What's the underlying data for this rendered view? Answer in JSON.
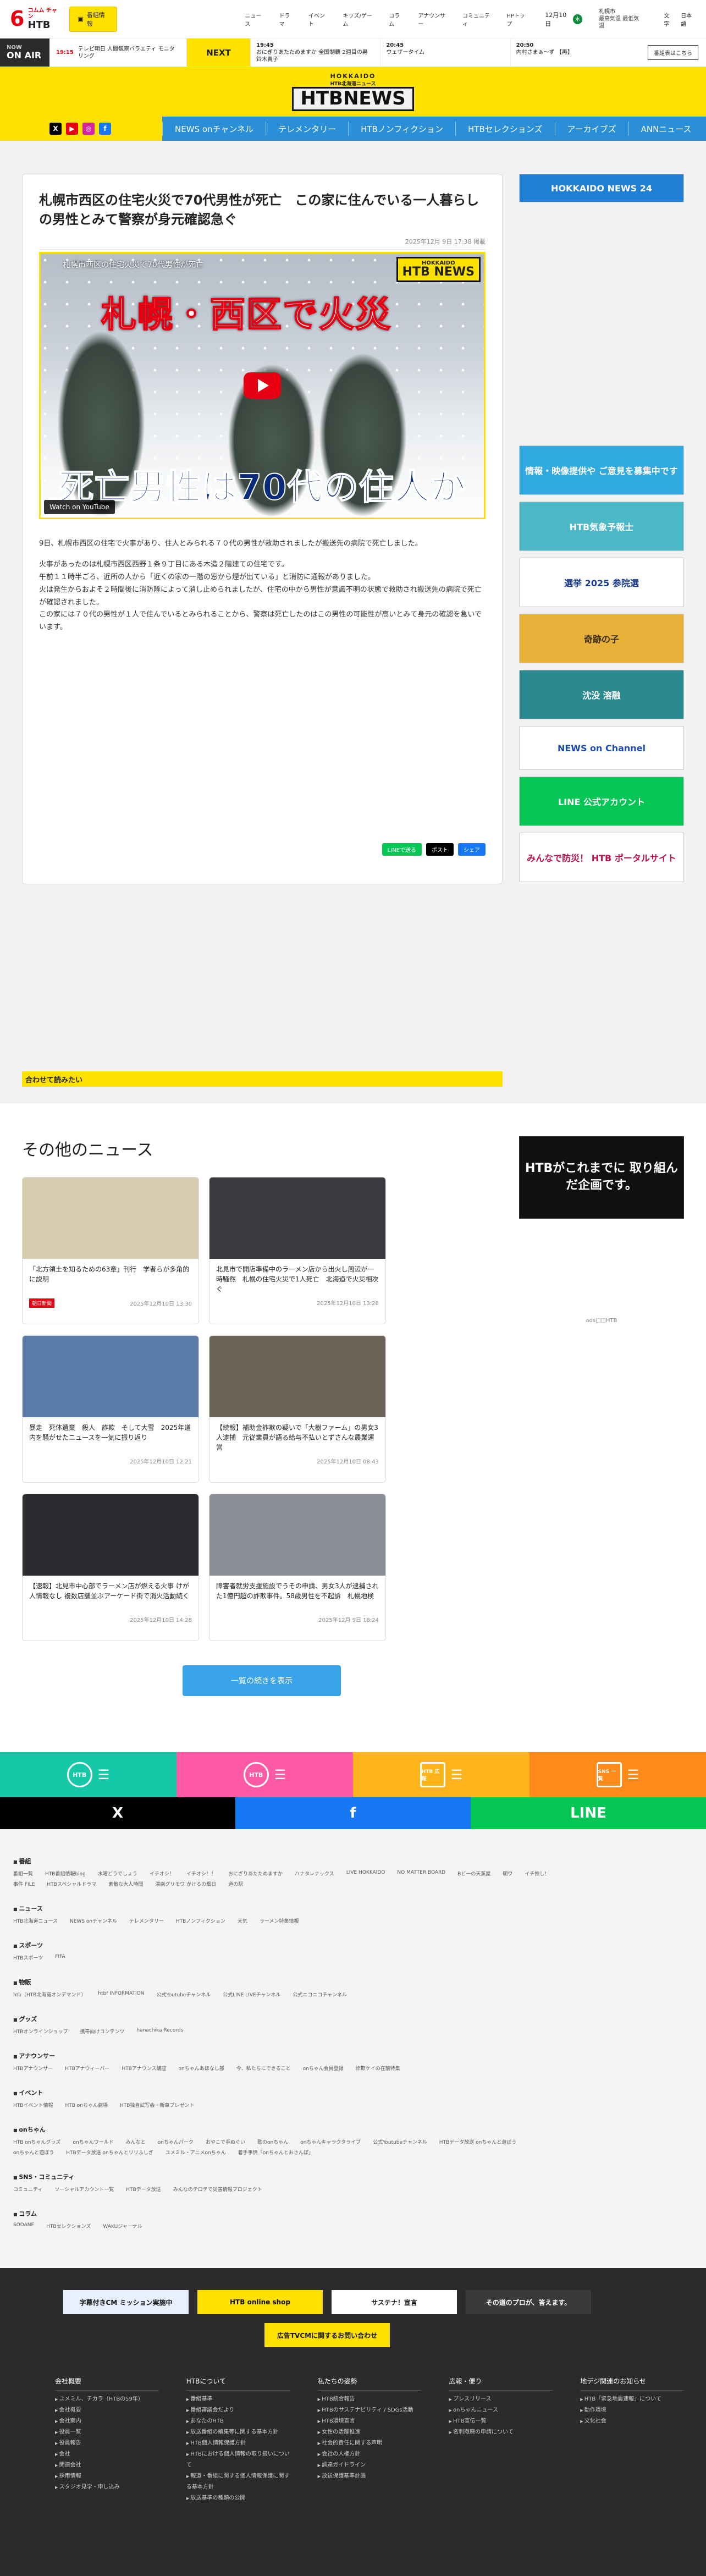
{
  "header": {
    "logo_six": "6",
    "logo_top": "コムム チャン",
    "logo_main": "HTB",
    "tv_button": "番組情報",
    "nav": [
      "ニュース",
      "ドラマ",
      "イベント",
      "キッズ/ゲーム",
      "コラム",
      "アナウンサー",
      "コミュニティ",
      "HPトップ"
    ],
    "date": "12月10日",
    "date_day": "水",
    "weather_top": "札幌市",
    "weather_sub": "最高気温 最低気温",
    "kanji": [
      "文字",
      "日本語"
    ]
  },
  "onair": {
    "label": "ON AIR",
    "now": "NOW",
    "now_time": "19:15",
    "now_title": "テレビ朝日 人間観察バラエティ モニタリング",
    "next_tag": "NEXT",
    "items": [
      {
        "time": "19:45",
        "title": "おにぎりあたためますか 全国制覇 2週目の男 鈴木貴子"
      },
      {
        "time": "20:45",
        "title": "ウェザータイム"
      },
      {
        "time": "20:50",
        "title": "内村さまぁ～ず 【再】"
      }
    ],
    "program_button": "番組表はこちら"
  },
  "brand": {
    "hokkaido": "HOKKAIDO",
    "sub": "HTB北海道ニュース",
    "logo": "HTBNEWS"
  },
  "subnav": [
    "NEWS onチャンネル",
    "テレメンタリー",
    "HTBノンフィクション",
    "HTBセレクションズ",
    "アーカイブズ",
    "ANNニュース"
  ],
  "article": {
    "title": "札幌市西区の住宅火災で70代男性が死亡　この家に住んでいる一人暮らしの男性とみて警察が身元確認急ぐ",
    "date": "2025年12月 9日 17:38 掲載",
    "video": {
      "caption": "札幌市西区の住宅火災で70代男性が死亡",
      "headline_top": "札幌・西区で火災",
      "headline_bottom": "死亡男性は70代の住人か",
      "badge_top": "HOKKAIDO",
      "badge_main": "HTB NEWS",
      "watch_on": "Watch on YouTube"
    },
    "paragraphs": [
      "9日、札幌市西区の住宅で火事があり、住人とみられる７０代の男性が救助されましたが搬送先の病院で死亡しました。",
      "火事があったのは札幌市西区西野１条９丁目にある木造２階建ての住宅です。\n午前１１時半ごろ、近所の人から「近くの家の一階の窓から煙が出ている」と消防に通報がありました。\n火は発生からおよそ２時間後に消防隊によって消し止められましたが、住宅の中から男性が意識不明の状態で救助され搬送先の病院で死亡が確認されました。\nこの家には７０代の男性が１人で住んでいるとみられることから、警察は死亡したのはこの男性の可能性が高いとみて身元の確認を急いでいます。"
    ],
    "share": [
      "LINEで送る",
      "ポスト",
      "シェア"
    ]
  },
  "sidebar": [
    {
      "text": "HOKKAIDO NEWS 24",
      "bg": "#1f7fd4",
      "fg": "#ffffff",
      "h": 52
    },
    {
      "text": "情報・映像提供や ご意見を募集中です",
      "bg": "#30a8e0",
      "fg": "#ffffff",
      "h": 90
    },
    {
      "text": "HTB気象予報士",
      "bg": "#4bb8c8",
      "fg": "#ffffff",
      "h": 90
    },
    {
      "text": "選挙 2025 参院選",
      "bg": "#ffffff",
      "fg": "#1a3c8e",
      "h": 90
    },
    {
      "text": "奇跡の子",
      "bg": "#e8b23a",
      "fg": "#3a2a10",
      "h": 90
    },
    {
      "text": "沈没 溶融",
      "bg": "#2a8a90",
      "fg": "#ffffff",
      "h": 90
    },
    {
      "text": "NEWS on Channel",
      "bg": "#ffffff",
      "fg": "#1a4bb0",
      "h": 80
    },
    {
      "text": "LINE 公式アカウント",
      "bg": "#06c755",
      "fg": "#ffffff",
      "h": 90
    },
    {
      "text": "みんなで防災！ HTB ポータルサイト",
      "bg": "#ffffff",
      "fg": "#c0124a",
      "h": 90
    }
  ],
  "related": {
    "label": "合わせて読みたい"
  },
  "others": {
    "title": "その他のニュース",
    "cards": [
      {
        "title": "「北方領土を知るための63章」刊行　学者らが多角的に説明",
        "date": "2025年12月10日 13:30",
        "tag": "朝日新聞",
        "img": "#d8cdb0"
      },
      {
        "title": "北見市で開店準備中のラーメン店から出火し周辺が一時騒然　札幌の住宅火災で1人死亡　北海道で火災相次ぐ",
        "date": "2025年12月10日 13:28",
        "tag": "",
        "img": "#3a3a40"
      },
      {
        "title": "暴走　死体遺棄　殺人　詐欺　そして大雪　2025年道内を騒がせたニュースを一気に振り返り",
        "date": "2025年12月10日 12:21",
        "tag": "",
        "img": "#5b7ca8"
      },
      {
        "title": "【続報】補助金詐欺の疑いで「大樹ファーム」の男女3人逮捕　元従業員が語る給与不払いとずさんな農業運営",
        "date": "2025年12月10日 08:43",
        "tag": "",
        "img": "#6a6256"
      },
      {
        "title": "【速報】北見市中心部でラーメン店が燃える火事 けが人情報なし 複数店舗並ぶアーケード街で消火活動続く",
        "date": "2025年12月10日 14:28",
        "tag": "",
        "img": "#2a2a30"
      },
      {
        "title": "障害者就労支援施設でうその申請、男女3人が逮捕された1億円超の詐欺事件。58歳男性を不起訴　札幌地検",
        "date": "2025年12月 9日 18:24",
        "tag": "",
        "img": "#8a8f98"
      }
    ],
    "more": "一覧の続きを表示",
    "ad": "HTBがこれまでに 取り組んだ企画です。",
    "ad_sub": "ads□□HTB"
  },
  "strip": [
    "HTB",
    "HTB",
    "HTB 広報",
    "SNS 一覧"
  ],
  "share_strip": [
    "X",
    "f",
    "LINE"
  ],
  "sitemap": [
    {
      "title": "番組",
      "links": [
        "番組一覧",
        "HTB番組情報blog",
        "水曜どうでしょう",
        "イチオシ！",
        "イチオシ！！",
        "おにぎりあたためますか",
        "ハナタレナックス",
        "LIVE HOKKAIDO",
        "NO MATTER BOARD",
        "Bビーの天蒸屋",
        "朝ワ",
        "イチ推し！",
        "事件 FILE",
        "HTBスペシャルドラマ",
        "素敵な大人時間",
        "演劇グリモワ かけるの畑日",
        "道の駅"
      ]
    },
    {
      "title": "ニュース",
      "links": [
        "HTB北海道ニュース",
        "NEWS onチャンネル",
        "テレメンタリー",
        "HTBノンフィクション",
        "天気",
        "ラーメン特集情報"
      ]
    },
    {
      "title": "スポーツ",
      "links": [
        "HTBスポーツ",
        "FIFA"
      ]
    },
    {
      "title": "物販",
      "links": [
        "htb（HTB北海道オンデマンド）",
        "htbf INFORMATION",
        "公式Youtubeチャンネル",
        "公式LINE LIVEチャンネル",
        "公式ニコニコチャンネル"
      ]
    },
    {
      "title": "グッズ",
      "links": [
        "HTBオンラインショップ",
        "携帯向けコンテンツ",
        "hanachika Records"
      ]
    },
    {
      "title": "アナウンサー",
      "links": [
        "HTBアナウンサー",
        "HTBアナウィーバー",
        "HTBアナウンス講座",
        "onちゃんあほなし部",
        "今、私たちにできること",
        "onちゃん会員登録",
        "詐欺ケイの在前特集"
      ]
    },
    {
      "title": "イベント",
      "links": [
        "HTBイベント情報",
        "HTB onちゃん劇場",
        "HTB独自試写会・新車プレゼント"
      ]
    },
    {
      "title": "onちゃん",
      "links": [
        "HTB onちゃんグッズ",
        "onちゃんワールド",
        "みんなと",
        "onちゃんパーク",
        "おやこで手ぬぐい",
        "歌のonちゃん",
        "onちゃんキャラクタライブ",
        "公式Youtubeチャンネル",
        "HTBデータ放送 onちゃんと遊ぼう",
        "onちゃんと遊ぼう",
        "HTBデータ放送 onちゃんとリリふしぎ",
        "ユメミル・アニメonちゃん",
        "着手事情「onちゃんとおさんぽ」"
      ]
    },
    {
      "title": "SNS・コミュニティ",
      "links": [
        "コミュニティ",
        "ソーシャルアカウント一覧",
        "HTBデータ放送",
        "みんなのテロテで災害情報プロジェクト"
      ]
    },
    {
      "title": "コラム",
      "links": [
        "SODANE",
        "HTBセレクションズ",
        "WAKUジャーナル"
      ]
    }
  ],
  "footer": {
    "banners": [
      {
        "text": "字幕付きCM ミッション実施中",
        "bg": "#e8f0ff"
      },
      {
        "text": "HTB online shop",
        "bg": "#ffe100"
      },
      {
        "text": "サステナ！宣言",
        "bg": "#ffffff"
      },
      {
        "text": "その道のプロが、答えます。",
        "bg": "#3a3a3a"
      },
      {
        "text": "広告TVCMに関するお問い合わせ",
        "bg": "#ffe100"
      }
    ],
    "cols": [
      {
        "title": "会社概要",
        "items": [
          "ユメミル、チカラ（HTBの59年）",
          "会社概要",
          "会社案内",
          "役員一覧",
          "役員報告",
          "会社",
          "関連会社",
          "採用情報",
          "スタジオ見学・申し込み"
        ]
      },
      {
        "title": "HTBについて",
        "items": [
          "番組基準",
          "番組審議会だより",
          "あなたのHTB",
          "放送番組の編集等に関する基本方針",
          "HTB個人情報保護方針",
          "HTBにおける個人情報の取り扱いについて",
          "報道・番組に関する個人情報保護に関する基本方針",
          "放送基準の種類の公開"
        ]
      },
      {
        "title": "私たちの姿勢",
        "items": [
          "HTB統合報告",
          "HTBのサステナビリティ / SDGs活動",
          "HTB環境宣言",
          "女性の活躍推進",
          "社会的責任に関する声明",
          "会社の人権方針",
          "調達ガイドライン",
          "放送保護基準計画"
        ]
      },
      {
        "title": "広報・便り",
        "items": [
          "プレスリリース",
          "onちゃんニュース",
          "HTB宣伝一覧",
          "名刺撤廃の申請について"
        ]
      },
      {
        "title": "地デジ関連のお知らせ",
        "items": [
          "HTB「緊急地震速報」について",
          "動作環境",
          "文化社会"
        ]
      }
    ]
  }
}
